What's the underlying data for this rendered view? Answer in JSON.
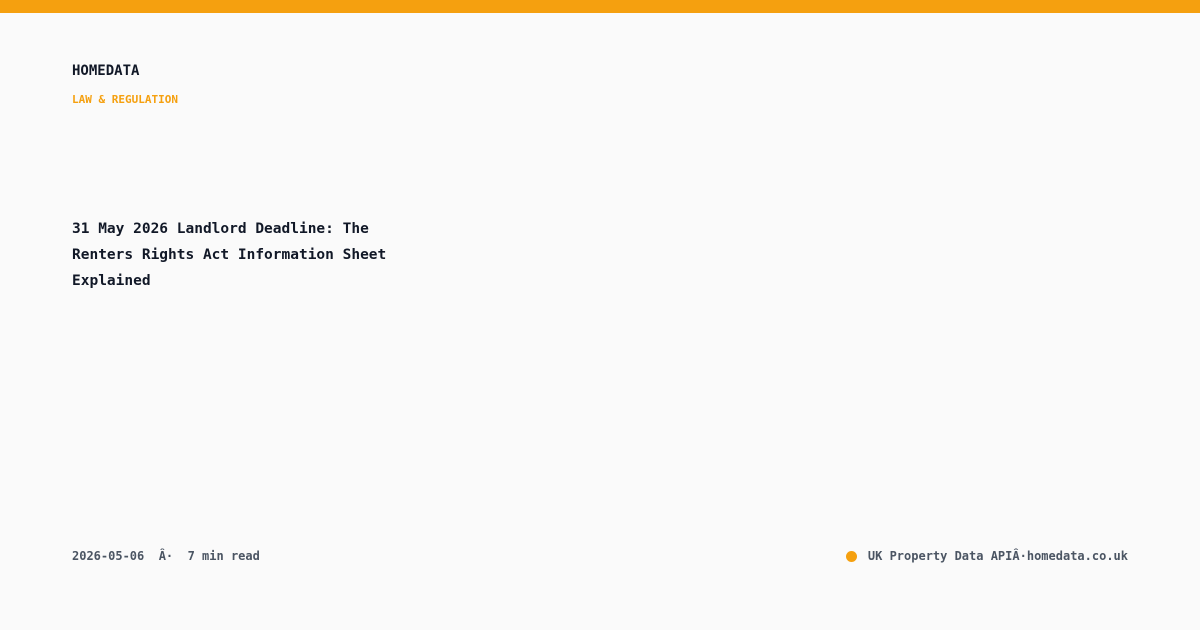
{
  "header": {
    "brand": "HOMEDATA",
    "category": "LAW & REGULATION"
  },
  "article": {
    "title": "31 May 2026 Landlord Deadline: The Renters Rights Act Information Sheet Explained"
  },
  "footer": {
    "date": "2026-05-06",
    "separator": "Â·",
    "read_time": "7 min read",
    "product": "UK Property Data API",
    "site": "homedata.co.uk"
  },
  "colors": {
    "accent": "#f5a00f",
    "text": "#111827",
    "muted": "#4b5563",
    "background": "#fafafa"
  }
}
